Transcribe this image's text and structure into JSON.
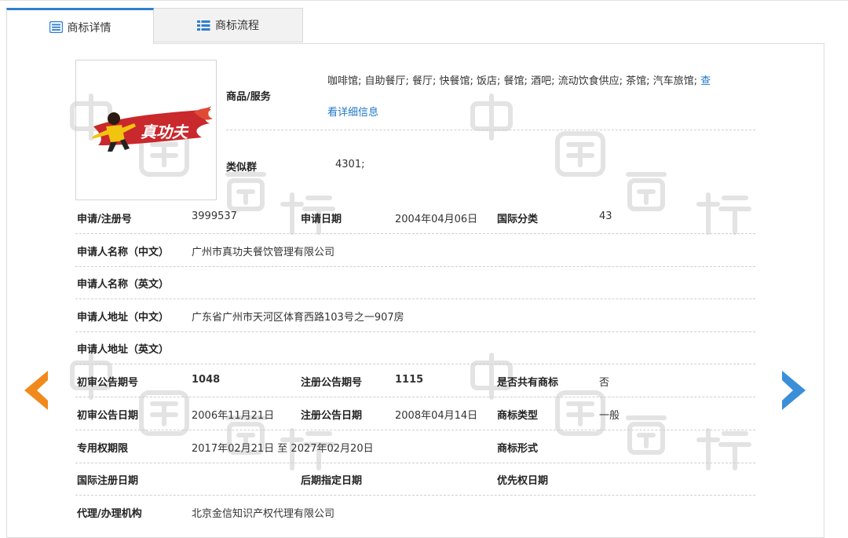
{
  "tabs": [
    {
      "label": "商标详情",
      "icon": "list-detail-icon",
      "active": true
    },
    {
      "label": "商标流程",
      "icon": "list-flow-icon",
      "active": false
    }
  ],
  "watermark": {
    "chars": [
      "中",
      "国",
      "商",
      "标"
    ]
  },
  "logo": {
    "text": "真功夫"
  },
  "goods": {
    "label": "商品/服务",
    "line1": "咖啡馆; 自助餐厅; 餐厅; 快餐馆; 饭店; 餐馆; 酒吧; 流动饮食供应; 茶馆; 汽车旅馆;",
    "link_part1": "查",
    "link_part2": "看详细信息"
  },
  "similar": {
    "label": "类似群",
    "value": "4301;"
  },
  "rows": {
    "reg_no": {
      "label": "申请/注册号",
      "value": "3999537"
    },
    "app_date": {
      "label": "申请日期",
      "value": "2004年04月06日"
    },
    "intl_class": {
      "label": "国际分类",
      "value": "43"
    },
    "applicant_cn": {
      "label": "申请人名称（中文）",
      "value": "广州市真功夫餐饮管理有限公司"
    },
    "applicant_en": {
      "label": "申请人名称（英文）",
      "value": ""
    },
    "address_cn": {
      "label": "申请人地址（中文）",
      "value": "广东省广州市天河区体育西路103号之一907房"
    },
    "address_en": {
      "label": "申请人地址（英文）",
      "value": ""
    },
    "prelim_no": {
      "label": "初审公告期号",
      "value": "1048"
    },
    "reg_pub_no": {
      "label": "注册公告期号",
      "value": "1115"
    },
    "shared": {
      "label": "是否共有商标",
      "value": "否"
    },
    "prelim_date": {
      "label": "初审公告日期",
      "value": "2006年11月21日"
    },
    "reg_pub_date": {
      "label": "注册公告日期",
      "value": "2008年04月14日"
    },
    "tm_type": {
      "label": "商标类型",
      "value": "一般"
    },
    "exclusive": {
      "label": "专用权期限",
      "value": "2017年02月21日 至 2027年02月20日"
    },
    "tm_form": {
      "label": "商标形式",
      "value": ""
    },
    "intl_reg_date": {
      "label": "国际注册日期",
      "value": ""
    },
    "later_date": {
      "label": "后期指定日期",
      "value": ""
    },
    "priority_date": {
      "label": "优先权日期",
      "value": ""
    },
    "agent": {
      "label": "代理/办理机构",
      "value": "北京金信知识产权代理有限公司"
    }
  },
  "nav": {
    "prev_color": "#f08a1c",
    "next_color": "#3a8fd8"
  }
}
